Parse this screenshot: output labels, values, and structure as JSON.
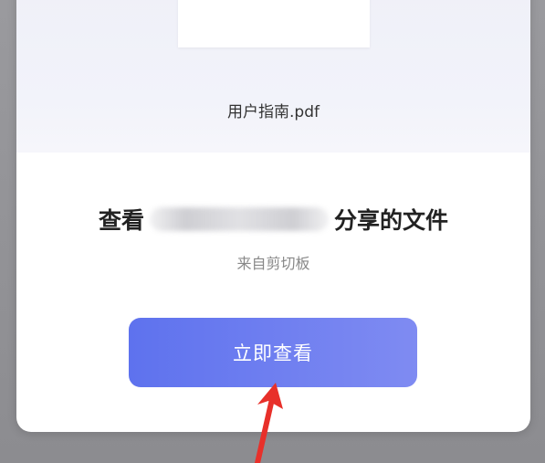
{
  "file_card": {
    "file_name": "用户指南.pdf"
  },
  "share_info": {
    "title_prefix": "查看",
    "title_suffix": "分享的文件",
    "subtitle": "来自剪切板"
  },
  "actions": {
    "view_now_label": "立即查看"
  },
  "colors": {
    "button_start": "#5e72ee",
    "button_end": "#7f8bf2",
    "arrow": "#e8302a"
  }
}
